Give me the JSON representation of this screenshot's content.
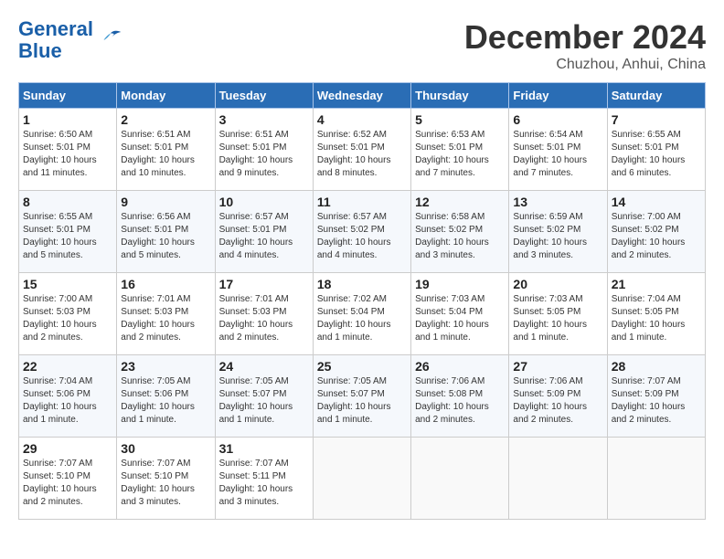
{
  "header": {
    "logo_line1": "General",
    "logo_line2": "Blue",
    "month": "December 2024",
    "location": "Chuzhou, Anhui, China"
  },
  "weekdays": [
    "Sunday",
    "Monday",
    "Tuesday",
    "Wednesday",
    "Thursday",
    "Friday",
    "Saturday"
  ],
  "weeks": [
    [
      {
        "day": "1",
        "sunrise": "6:50 AM",
        "sunset": "5:01 PM",
        "daylight": "10 hours and 11 minutes."
      },
      {
        "day": "2",
        "sunrise": "6:51 AM",
        "sunset": "5:01 PM",
        "daylight": "10 hours and 10 minutes."
      },
      {
        "day": "3",
        "sunrise": "6:51 AM",
        "sunset": "5:01 PM",
        "daylight": "10 hours and 9 minutes."
      },
      {
        "day": "4",
        "sunrise": "6:52 AM",
        "sunset": "5:01 PM",
        "daylight": "10 hours and 8 minutes."
      },
      {
        "day": "5",
        "sunrise": "6:53 AM",
        "sunset": "5:01 PM",
        "daylight": "10 hours and 7 minutes."
      },
      {
        "day": "6",
        "sunrise": "6:54 AM",
        "sunset": "5:01 PM",
        "daylight": "10 hours and 7 minutes."
      },
      {
        "day": "7",
        "sunrise": "6:55 AM",
        "sunset": "5:01 PM",
        "daylight": "10 hours and 6 minutes."
      }
    ],
    [
      {
        "day": "8",
        "sunrise": "6:55 AM",
        "sunset": "5:01 PM",
        "daylight": "10 hours and 5 minutes."
      },
      {
        "day": "9",
        "sunrise": "6:56 AM",
        "sunset": "5:01 PM",
        "daylight": "10 hours and 5 minutes."
      },
      {
        "day": "10",
        "sunrise": "6:57 AM",
        "sunset": "5:01 PM",
        "daylight": "10 hours and 4 minutes."
      },
      {
        "day": "11",
        "sunrise": "6:57 AM",
        "sunset": "5:02 PM",
        "daylight": "10 hours and 4 minutes."
      },
      {
        "day": "12",
        "sunrise": "6:58 AM",
        "sunset": "5:02 PM",
        "daylight": "10 hours and 3 minutes."
      },
      {
        "day": "13",
        "sunrise": "6:59 AM",
        "sunset": "5:02 PM",
        "daylight": "10 hours and 3 minutes."
      },
      {
        "day": "14",
        "sunrise": "7:00 AM",
        "sunset": "5:02 PM",
        "daylight": "10 hours and 2 minutes."
      }
    ],
    [
      {
        "day": "15",
        "sunrise": "7:00 AM",
        "sunset": "5:03 PM",
        "daylight": "10 hours and 2 minutes."
      },
      {
        "day": "16",
        "sunrise": "7:01 AM",
        "sunset": "5:03 PM",
        "daylight": "10 hours and 2 minutes."
      },
      {
        "day": "17",
        "sunrise": "7:01 AM",
        "sunset": "5:03 PM",
        "daylight": "10 hours and 2 minutes."
      },
      {
        "day": "18",
        "sunrise": "7:02 AM",
        "sunset": "5:04 PM",
        "daylight": "10 hours and 1 minute."
      },
      {
        "day": "19",
        "sunrise": "7:03 AM",
        "sunset": "5:04 PM",
        "daylight": "10 hours and 1 minute."
      },
      {
        "day": "20",
        "sunrise": "7:03 AM",
        "sunset": "5:05 PM",
        "daylight": "10 hours and 1 minute."
      },
      {
        "day": "21",
        "sunrise": "7:04 AM",
        "sunset": "5:05 PM",
        "daylight": "10 hours and 1 minute."
      }
    ],
    [
      {
        "day": "22",
        "sunrise": "7:04 AM",
        "sunset": "5:06 PM",
        "daylight": "10 hours and 1 minute."
      },
      {
        "day": "23",
        "sunrise": "7:05 AM",
        "sunset": "5:06 PM",
        "daylight": "10 hours and 1 minute."
      },
      {
        "day": "24",
        "sunrise": "7:05 AM",
        "sunset": "5:07 PM",
        "daylight": "10 hours and 1 minute."
      },
      {
        "day": "25",
        "sunrise": "7:05 AM",
        "sunset": "5:07 PM",
        "daylight": "10 hours and 1 minute."
      },
      {
        "day": "26",
        "sunrise": "7:06 AM",
        "sunset": "5:08 PM",
        "daylight": "10 hours and 2 minutes."
      },
      {
        "day": "27",
        "sunrise": "7:06 AM",
        "sunset": "5:09 PM",
        "daylight": "10 hours and 2 minutes."
      },
      {
        "day": "28",
        "sunrise": "7:07 AM",
        "sunset": "5:09 PM",
        "daylight": "10 hours and 2 minutes."
      }
    ],
    [
      {
        "day": "29",
        "sunrise": "7:07 AM",
        "sunset": "5:10 PM",
        "daylight": "10 hours and 2 minutes."
      },
      {
        "day": "30",
        "sunrise": "7:07 AM",
        "sunset": "5:10 PM",
        "daylight": "10 hours and 3 minutes."
      },
      {
        "day": "31",
        "sunrise": "7:07 AM",
        "sunset": "5:11 PM",
        "daylight": "10 hours and 3 minutes."
      },
      null,
      null,
      null,
      null
    ]
  ]
}
